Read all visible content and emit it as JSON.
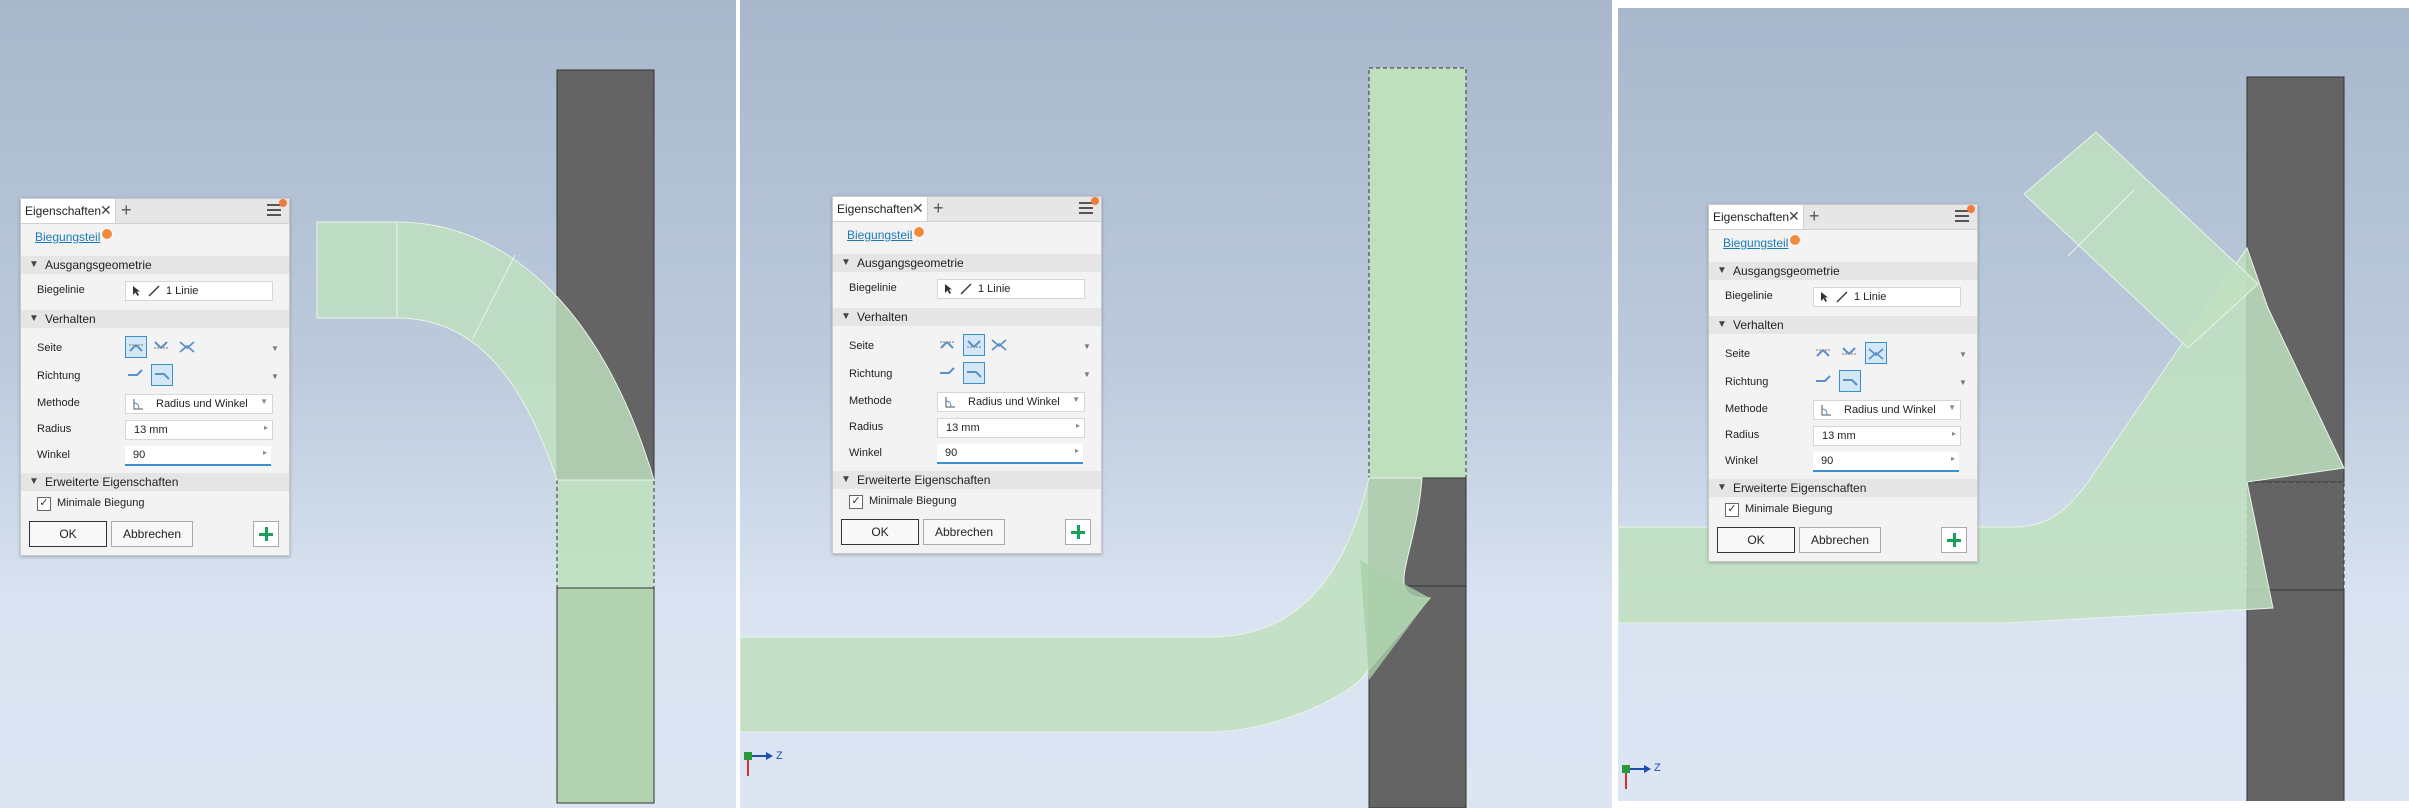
{
  "dialog": {
    "tab_title": "Eigenschaften",
    "tab_close": "✕",
    "tab_add": "+",
    "part_link": "Biegungsteil",
    "sections": {
      "source_geometry": "Ausgangsgeometrie",
      "behavior": "Verhalten",
      "advanced": "Erweiterte Eigenschaften"
    },
    "labels": {
      "bend_line": "Biegelinie",
      "side": "Seite",
      "direction": "Richtung",
      "method": "Methode",
      "radius": "Radius",
      "angle": "Winkel"
    },
    "values": {
      "bend_line": "1 Linie",
      "method": "Radius und Winkel",
      "radius": "13 mm",
      "angle": "90"
    },
    "checkbox_label": "Minimale Biegung",
    "checkbox_checked": true,
    "buttons": {
      "ok": "OK",
      "cancel": "Abbrechen"
    }
  },
  "panels": [
    {
      "side_selected": 1,
      "direction_selected": 2,
      "triad": null
    },
    {
      "side_selected": 2,
      "direction_selected": 2,
      "triad": "Z"
    },
    {
      "side_selected": 3,
      "direction_selected": 2,
      "triad": "Z"
    }
  ],
  "colors": {
    "background_top": "#a9b7cc",
    "background_bottom": "#dce5f2",
    "part_dark": "#646464",
    "part_preview_green": "#bfe0bf",
    "accent_blue": "#3a8fcf",
    "link_blue": "#1a7ab8",
    "add_green": "#1aa05a",
    "badge_orange": "#f28b3c"
  }
}
